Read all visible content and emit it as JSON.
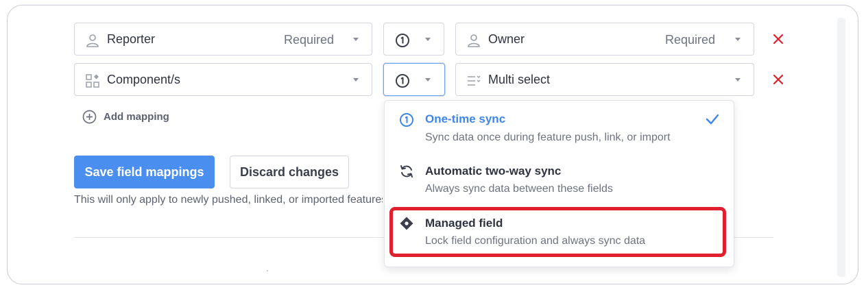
{
  "mappings": [
    {
      "source_field": "Reporter",
      "source_required": "Required",
      "sync_mode_icon": "one-time-sync-icon",
      "target_field": "Owner",
      "target_required": "Required"
    },
    {
      "source_field": "Component/s",
      "source_required": "",
      "sync_mode_icon": "one-time-sync-icon",
      "target_field": "Multi select",
      "target_required": ""
    }
  ],
  "add_mapping_label": "Add mapping",
  "save_button_label": "Save field mappings",
  "discard_button_label": "Discard changes",
  "hint_text": "This will only apply to newly pushed, linked, or imported features.",
  "sync_dropdown": {
    "options": [
      {
        "title": "One-time sync",
        "description": "Sync data once during feature push, link, or import",
        "icon": "one-time-sync-icon",
        "selected": true
      },
      {
        "title": "Automatic two-way sync",
        "description": "Always sync data between these fields",
        "icon": "two-way-sync-icon",
        "selected": false
      },
      {
        "title": "Managed field",
        "description": "Lock field configuration and always sync data",
        "icon": "managed-field-diamond-icon",
        "selected": false,
        "highlighted": true
      }
    ]
  },
  "colors": {
    "primary": "#4a8eef",
    "selected_option": "#3f86ea",
    "remove": "#e0202e",
    "highlight": "#e0202e"
  }
}
